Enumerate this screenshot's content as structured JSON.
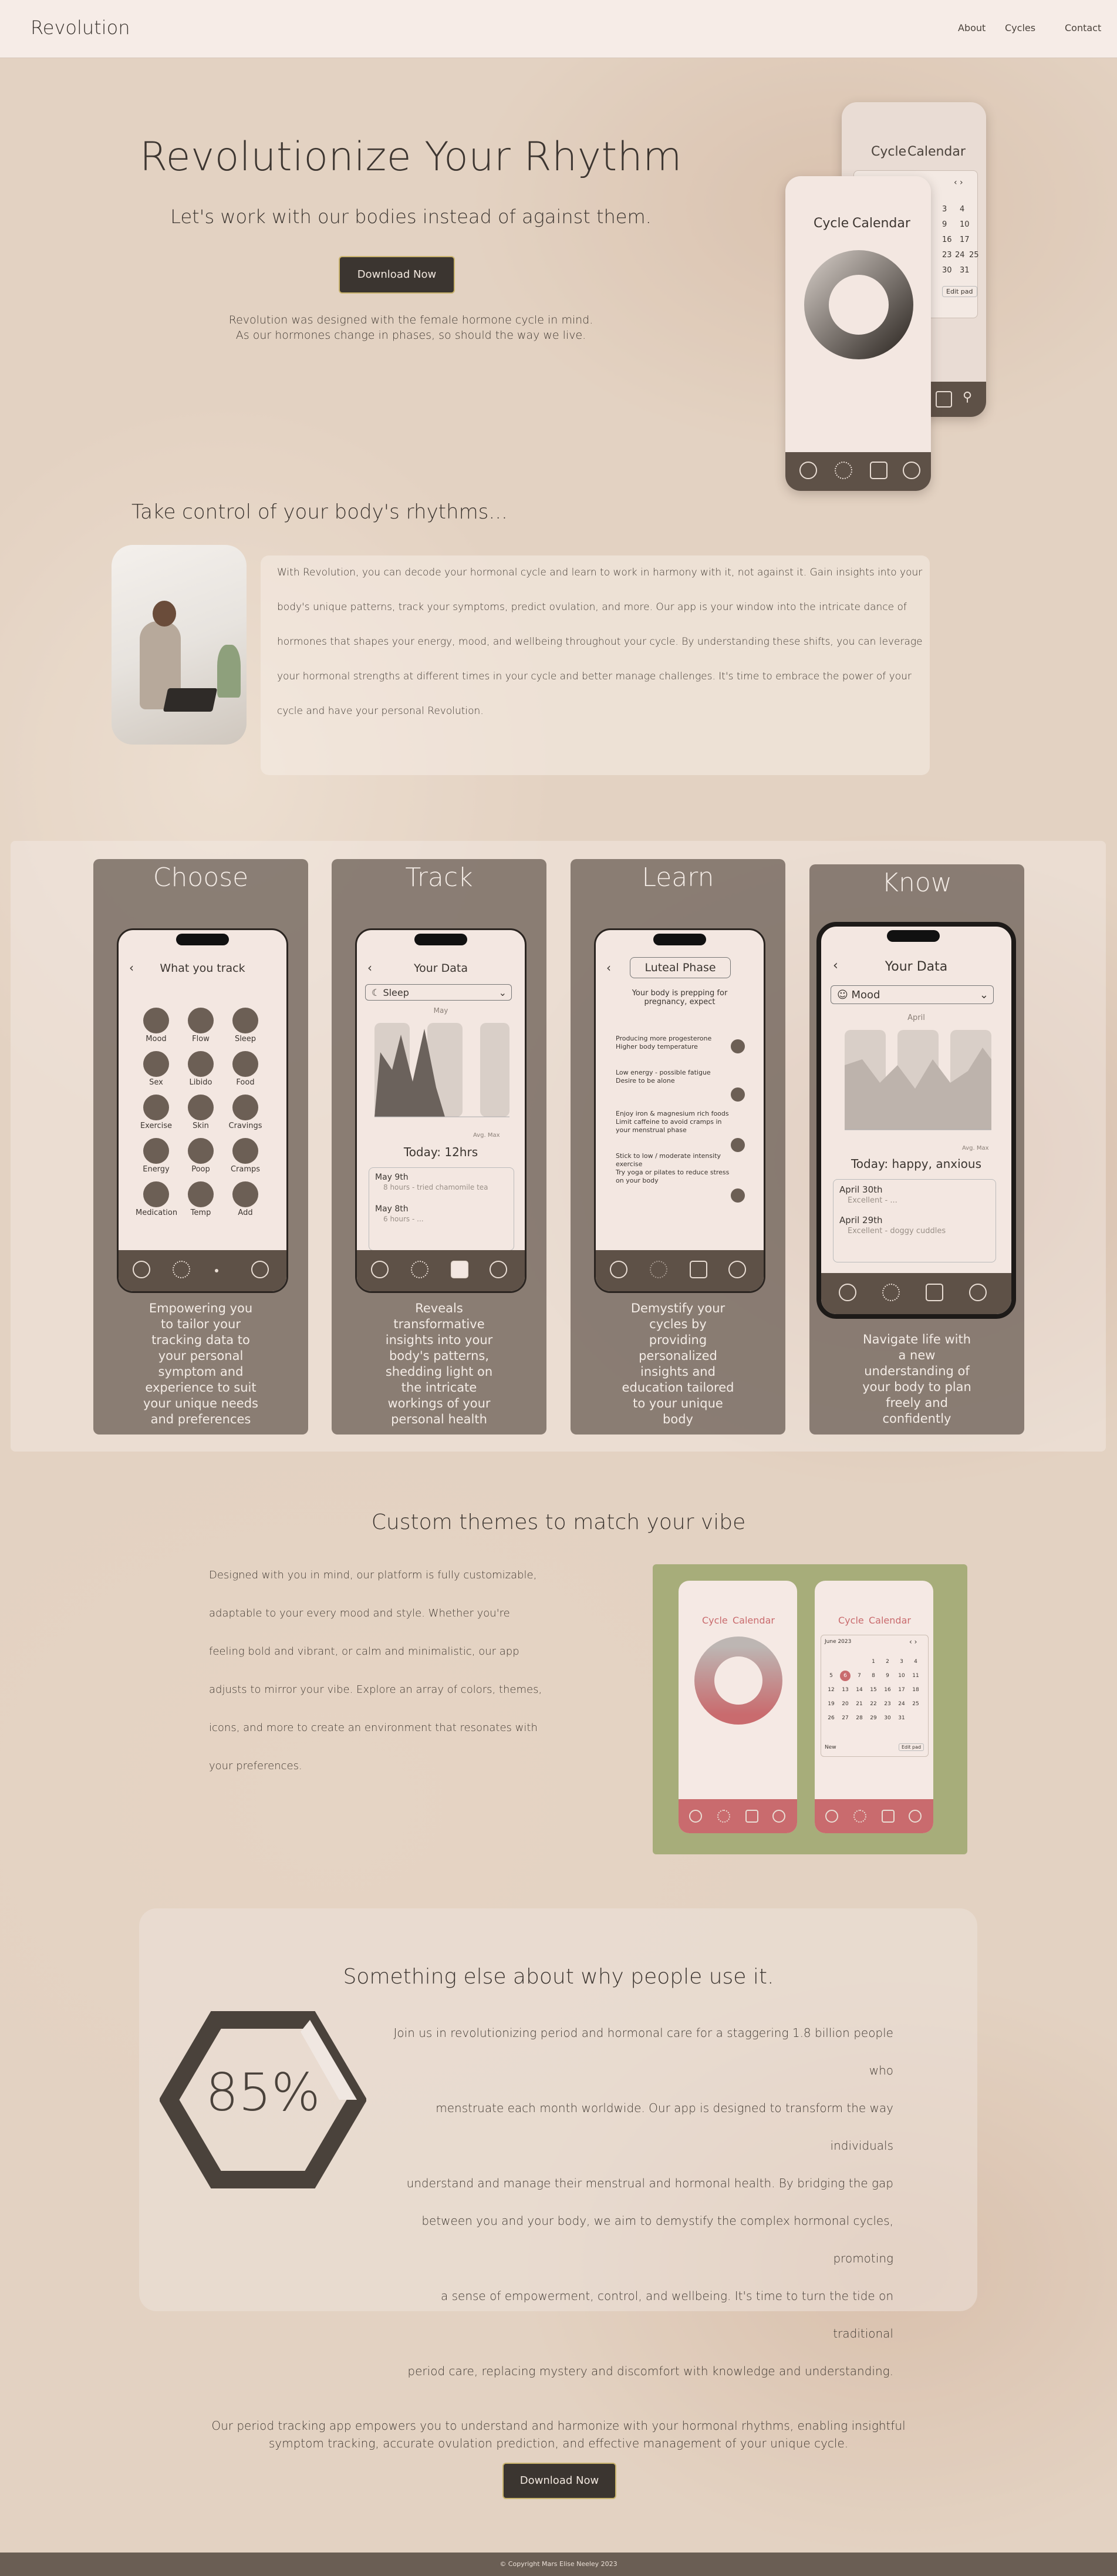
{
  "header": {
    "logo": "Revolution",
    "nav": [
      "About",
      "Cycles",
      "Contact"
    ]
  },
  "hero": {
    "title": "Revolutionize Your Rhythm",
    "subtitle": "Let's work with our bodies instead of against them.",
    "cta": "Download Now",
    "text_line1": "Revolution was designed with the female hormone cycle in mind.",
    "text_line2": "As our hormones change in phases, so should the way we live."
  },
  "hero_phones": {
    "back": {
      "tab_cycle": "Cycle",
      "tab_calendar": "Calendar",
      "dates": [
        "3",
        "4",
        "9",
        "10",
        "16",
        "17",
        "23",
        "24",
        "25",
        "30",
        "31"
      ],
      "edit": "Edit pad"
    },
    "front": {
      "tab_cycle": "Cycle",
      "tab_calendar": "Calendar"
    }
  },
  "control": {
    "title": "Take control of your body's rhythms...",
    "lines": [
      "With Revolution, you can decode your hormonal cycle and learn to work in harmony with it, not against it. Gain insights into your",
      "body's unique patterns, track your symptoms, predict ovulation, and more. Our app is your window into the intricate dance of",
      "hormones that shapes your energy, mood, and wellbeing throughout your cycle. By understanding these shifts, you can leverage",
      "your hormonal strengths at different times in your cycle and better manage challenges. It's time to embrace the power of your",
      "cycle and have your personal Revolution."
    ]
  },
  "cards": [
    {
      "title": "Choose",
      "screen_title": "What you track",
      "icons": [
        "Mood",
        "Flow",
        "Sleep",
        "Sex",
        "Libido",
        "Food",
        "Exercise",
        "Skin",
        "Cravings",
        "Energy",
        "Poop",
        "Cramps",
        "Medication",
        "Temp",
        "Add"
      ],
      "text": [
        "Empowering you",
        "to tailor your",
        "tracking data to",
        "your personal",
        "symptom and",
        "experience to suit",
        "your unique needs",
        "and preferences"
      ]
    },
    {
      "title": "Track",
      "screen_title": "Your Data",
      "selector": "Sleep",
      "month": "May",
      "axis_note": "Avg. Max",
      "today": "Today:  12hrs",
      "entries": [
        {
          "date": "May 9th",
          "note": "8 hours - tried chamomile tea"
        },
        {
          "date": "May 8th",
          "note": "6 hours - ..."
        }
      ],
      "text": [
        "Reveals",
        "transformative",
        "insights into your",
        "body's patterns,",
        "shedding light on",
        "the intricate",
        "workings of your",
        "personal health"
      ]
    },
    {
      "title": "Learn",
      "screen_title": "Luteal Phase",
      "intro": [
        "Your body is prepping for",
        "pregnancy, expect"
      ],
      "bullets": [
        "Producing more progesterone",
        "Higher body temperature",
        "Low energy - possible fatigue",
        "Desire to be alone",
        "Enjoy iron & magnesium rich foods",
        "Limit caffeine to avoid cramps in your menstrual phase",
        "Stick to low / moderate intensity exercise",
        "Try yoga or pilates to reduce stress on your body"
      ],
      "text": [
        "Demystify your",
        "cycles by",
        "providing",
        "personalized",
        "insights and",
        "education tailored",
        "to your unique",
        "body"
      ]
    },
    {
      "title": "Know",
      "screen_title": "Your Data",
      "selector": "Mood",
      "month": "April",
      "axis_note": "Avg. Max",
      "today": "Today:  happy, anxious",
      "entries": [
        {
          "date": "April 30th",
          "note": "Excellent - ..."
        },
        {
          "date": "April 29th",
          "note": "Excellent - doggy cuddles"
        }
      ],
      "text": [
        "Navigate life with",
        "a new",
        "understanding of",
        "your body to plan",
        "freely and",
        "confidently"
      ]
    }
  ],
  "themes": {
    "title": "Custom themes to match your vibe",
    "lines": [
      "Designed with you in mind, our platform is fully customizable,",
      "adaptable to your every mood and style. Whether you're",
      "feeling bold and vibrant, or calm and minimalistic, our app",
      "adjusts to mirror your vibe. Explore an array of colors, themes,",
      "icons, and more to create an environment that resonates with",
      "your preferences."
    ],
    "phone_tab_cycle": "Cycle",
    "phone_tab_calendar": "Calendar",
    "calendar_month": "June 2023",
    "calendar_days": [
      "1",
      "2",
      "3",
      "4",
      "5",
      "6",
      "7",
      "8",
      "9",
      "10",
      "11",
      "12",
      "13",
      "14",
      "15",
      "16",
      "17",
      "18",
      "19",
      "20",
      "21",
      "22",
      "23",
      "24",
      "25",
      "26",
      "27",
      "28",
      "29",
      "30",
      "31"
    ],
    "calendar_today": "New",
    "calendar_edit": "Edit pad",
    "accent": "#c96b6e",
    "panel_color": "#a7ad7a"
  },
  "stats": {
    "title": "Something else about why people use it.",
    "percent": "85%",
    "percent_value": 85,
    "lines": [
      "Join us in revolutionizing period and hormonal care for a staggering 1.8 billion people who",
      "menstruate each month worldwide. Our app is designed to transform the way individuals",
      "understand and manage their menstrual and hormonal health. By bridging the gap",
      "between you and your body, we aim to demystify the complex hormonal cycles, promoting",
      "a sense of empowerment, control, and wellbeing. It's time to turn the tide on traditional",
      "period care, replacing mystery and discomfort with knowledge and understanding."
    ]
  },
  "closing": {
    "line1": "Our period tracking app empowers you to understand and harmonize with your hormonal rhythms, enabling insightful",
    "line2": "symptom tracking, accurate ovulation prediction, and effective management of your unique cycle.",
    "cta": "Download Now"
  },
  "footer": {
    "copyright": "© Copyright Mars Elise Neeley 2023"
  },
  "colors": {
    "primary": "#3b3530",
    "bar": "#5e5147",
    "card": "#6e6258",
    "accent_gold": "#c9b36c"
  }
}
